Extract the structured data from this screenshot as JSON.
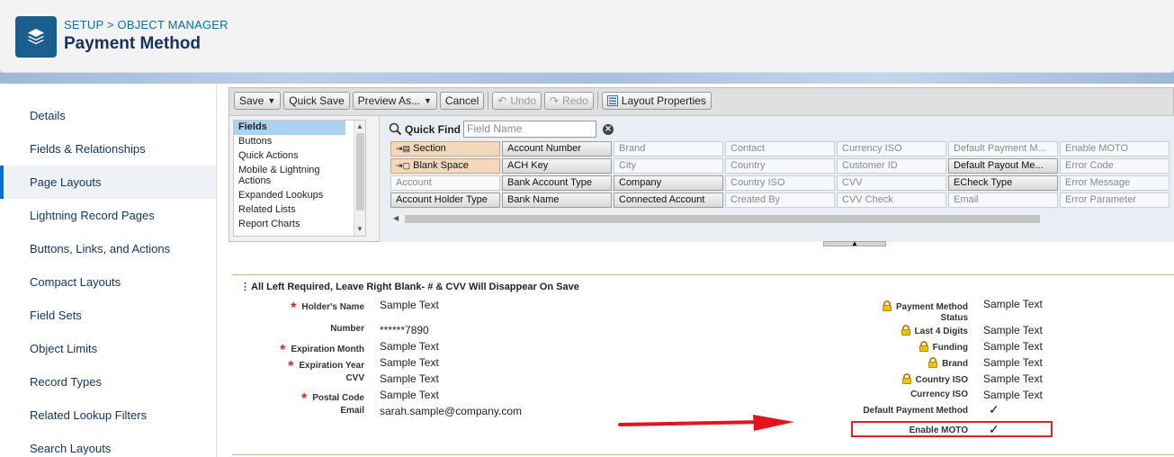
{
  "header": {
    "breadcrumb": "SETUP > OBJECT MANAGER",
    "title": "Payment Method",
    "icon": "layers-icon"
  },
  "sidebar": {
    "items": [
      {
        "label": "Details",
        "active": false
      },
      {
        "label": "Fields & Relationships",
        "active": false
      },
      {
        "label": "Page Layouts",
        "active": true
      },
      {
        "label": "Lightning Record Pages",
        "active": false
      },
      {
        "label": "Buttons, Links, and Actions",
        "active": false
      },
      {
        "label": "Compact Layouts",
        "active": false
      },
      {
        "label": "Field Sets",
        "active": false
      },
      {
        "label": "Object Limits",
        "active": false
      },
      {
        "label": "Record Types",
        "active": false
      },
      {
        "label": "Related Lookup Filters",
        "active": false
      },
      {
        "label": "Search Layouts",
        "active": false
      }
    ]
  },
  "toolbar": {
    "save": "Save",
    "quick_save": "Quick Save",
    "preview_as": "Preview As...",
    "cancel": "Cancel",
    "undo": "Undo",
    "redo": "Redo",
    "layout_properties": "Layout Properties"
  },
  "palette": {
    "categories": [
      "Fields",
      "Buttons",
      "Quick Actions",
      "Mobile & Lightning Actions",
      "Expanded Lookups",
      "Related Lists",
      "Report Charts"
    ],
    "quick_find_label": "Quick Find",
    "quick_find_placeholder": "Field Name",
    "field_columns": [
      [
        "Section",
        "Blank Space",
        "Account",
        "Account Holder Type"
      ],
      [
        "Account Number",
        "ACH Key",
        "Bank Account Type",
        "Bank Name"
      ],
      [
        "Brand",
        "City",
        "Company",
        "Connected Account"
      ],
      [
        "Contact",
        "Country",
        "Country ISO",
        "Created By"
      ],
      [
        "Currency ISO",
        "Customer ID",
        "CVV",
        "CVV Check"
      ],
      [
        "Default Payment M...",
        "Default Payout Me...",
        "ECheck Type",
        "Email"
      ],
      [
        "Enable MOTO",
        "Error Code",
        "Error Message",
        "Error Parameter"
      ]
    ]
  },
  "section": {
    "title": "All Left Required, Leave Right Blank- # & CVV Will Disappear On Save"
  },
  "left_fields": [
    {
      "label": "Holder's Name",
      "value": "Sample Text",
      "required": true
    },
    {
      "label": "Number",
      "value": "******7890",
      "required": false
    },
    {
      "label": "Expiration Month",
      "value": "Sample Text",
      "required": true
    },
    {
      "label": "Expiration Year",
      "value": "Sample Text",
      "required": true
    },
    {
      "label": "CVV",
      "value": "Sample Text",
      "required": false
    },
    {
      "label": "Postal Code",
      "value": "Sample Text",
      "required": true
    },
    {
      "label": "Email",
      "value": "sarah.sample@company.com",
      "required": false
    }
  ],
  "right_fields": [
    {
      "label": "Payment Method",
      "label2": "Status",
      "value": "Sample Text",
      "locked": true
    },
    {
      "label": "Last 4 Digits",
      "value": "Sample Text",
      "locked": true
    },
    {
      "label": "Funding",
      "value": "Sample Text",
      "locked": true
    },
    {
      "label": "Brand",
      "value": "Sample Text",
      "locked": true
    },
    {
      "label": "Country ISO",
      "value": "Sample Text",
      "locked": true
    },
    {
      "label": "Currency ISO",
      "value": "Sample Text",
      "locked": false
    },
    {
      "label": "Default Payment Method",
      "value": "✓",
      "locked": false
    },
    {
      "label": "Enable MOTO",
      "value": "✓",
      "locked": false
    }
  ],
  "colors": {
    "accent": "#0070d2",
    "required": "#d62a1f",
    "annotation": "#d9232a"
  }
}
